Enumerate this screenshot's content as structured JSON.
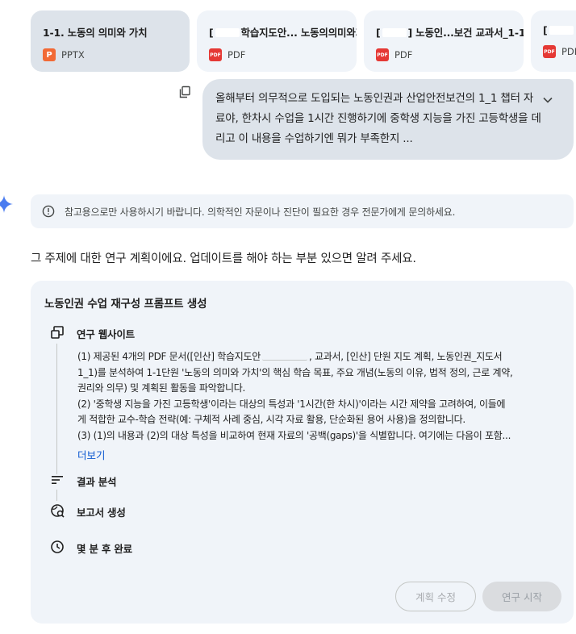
{
  "attachments": [
    {
      "title": "1-1. 노동의 의미와 가치",
      "type": "PPTX",
      "icon": "pptx-icon"
    },
    {
      "title_pre": "[",
      "title": "학습지도안... 노동의의미와가",
      "type": "PDF",
      "icon": "pdf-icon"
    },
    {
      "title_pre": "[",
      "title": "] 노동인...보건 교과서_1-1",
      "type": "PDF",
      "icon": "pdf-icon"
    },
    {
      "title_pre": "[",
      "title": "",
      "type": "PDF",
      "icon": "pdf-icon"
    }
  ],
  "user_message": {
    "text": "올해부터 의무적으로 도입되는 노동인권과 산업안전보건의 1_1 챕터 자료야, 한차시 수업을 1시간 진행하기에 중학생 지능을 가진 고등학생을 데리고 이 내용을 수업하기엔 뭐가 부족한지 ..."
  },
  "pdf_icon_text": "PDF",
  "pptx_icon_text": "P",
  "disclaimer": "참고용으로만 사용하시기 바랍니다. 의학적인 자문이나 진단이 필요한 경우 전문가에게 문의하세요.",
  "intro": "그 주제에 대한 연구 계획이에요. 업데이트를 해야 하는 부분 있으면 알려 주세요.",
  "plan": {
    "title": "노동인권 수업 재구성 프롬프트 생성",
    "steps": [
      {
        "label": "연구 웹사이트",
        "icon": "research-website-icon"
      },
      {
        "label": "결과 분석",
        "icon": "analyze-results-icon"
      },
      {
        "label": "보고서 생성",
        "icon": "generate-report-icon"
      },
      {
        "label": "몇 분 후 완료",
        "icon": "clock-icon"
      }
    ],
    "details": [
      "(1) 제공된 4개의 PDF 문서([인산] 학습지도안",
      ", 교과서, [인산] 단원 지도 계획, 노동인권_지도서",
      "1_1)를 분석하여 1-1단원 '노동의 의미와 가치'의 핵심 학습 목표, 주요 개념(노동의 이유, 법적 정의, 근로 계약,",
      "권리와 의무) 및 계획된 활동을 파악합니다.",
      "(2) '중학생 지능을 가진 고등학생'이라는 대상의 특성과 '1시간(한 차시)'이라는 시간 제약을 고려하여, 이들에",
      "게 적합한 교수-학습 전략(예: 구체적 사례 중심, 시각 자료 활용, 단순화된 용어 사용)을 정의합니다.",
      "(3) (1)의 내용과 (2)의 대상 특성을 비교하여 현재 자료의 '공백(gaps)'을 식별합니다. 여기에는 다음이 포함..."
    ],
    "more": "더보기",
    "edit_button": "계획 수정",
    "start_button": "연구 시작"
  }
}
